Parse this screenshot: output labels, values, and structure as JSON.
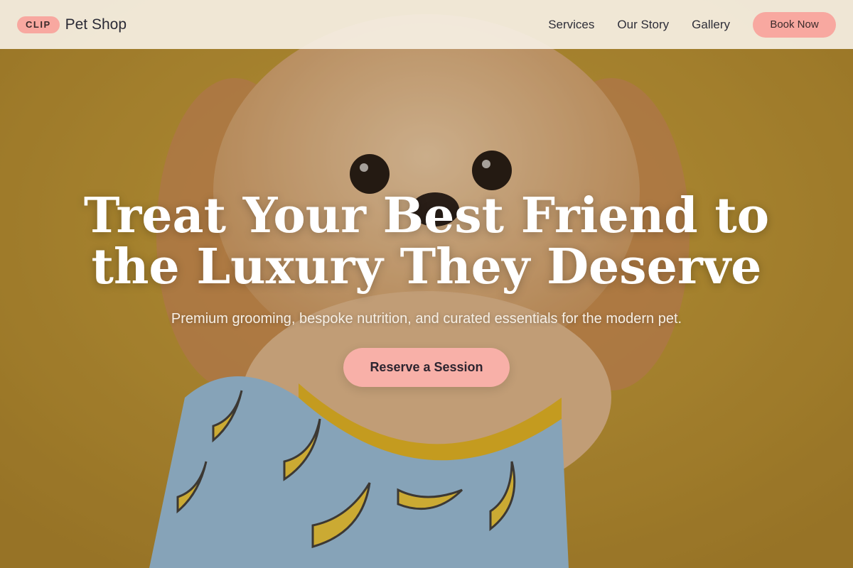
{
  "brand": {
    "badge": "CLIP",
    "name": "Pet Shop"
  },
  "nav": {
    "links": [
      {
        "label": "Services"
      },
      {
        "label": "Our Story"
      },
      {
        "label": "Gallery"
      }
    ],
    "book_label": "Book Now"
  },
  "hero": {
    "headline_line1": "Treat Your Best Friend to",
    "headline_line2": "the Luxury They Deserve",
    "subheadline": "Premium grooming, bespoke nutrition, and curated essentials for the modern pet.",
    "cta_label": "Reserve a Session"
  },
  "colors": {
    "accent": "#f8a8a0",
    "background": "#b8922e",
    "navbar": "#f6f0e4",
    "text_dark": "#2a2a35"
  },
  "icons": [
    "puppy-photo"
  ]
}
